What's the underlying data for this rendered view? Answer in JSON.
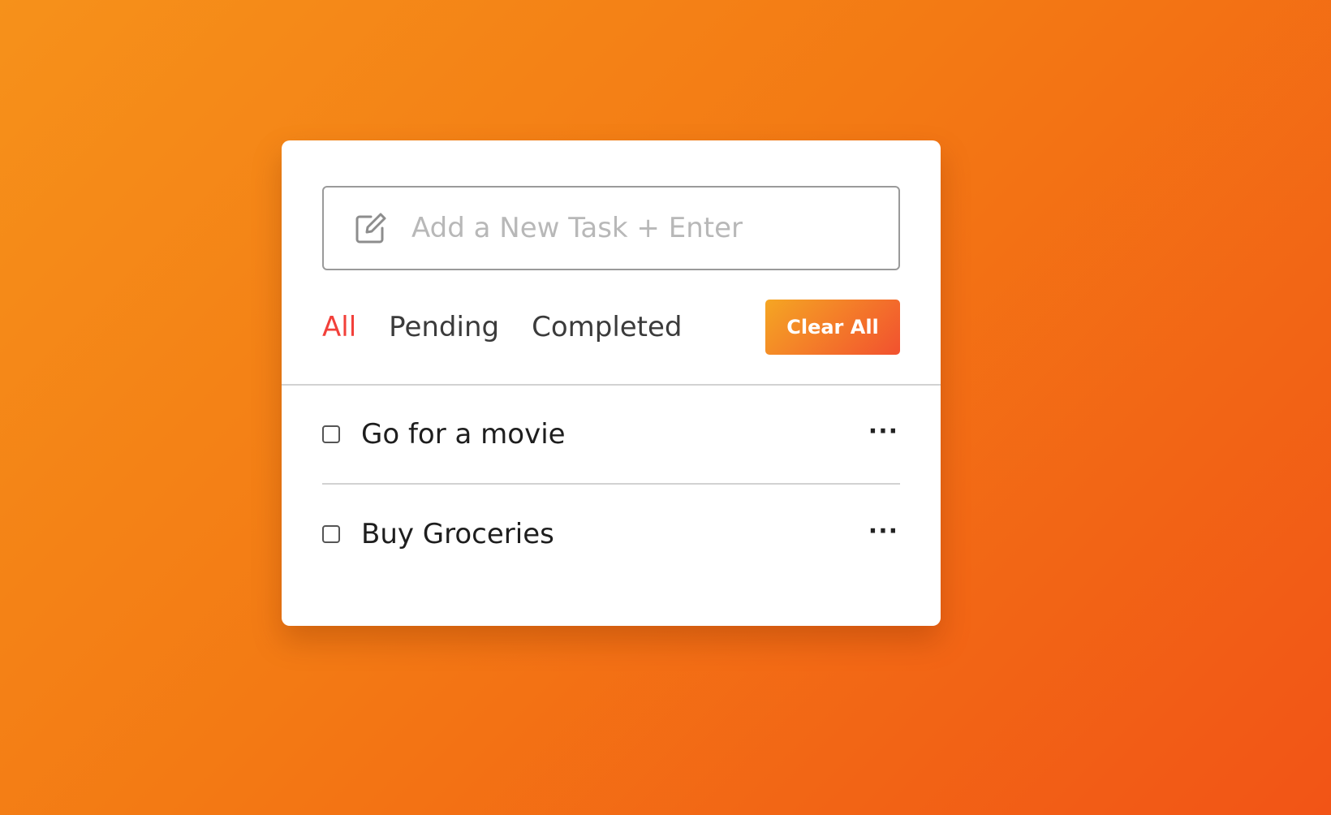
{
  "theme": {
    "background_gradient": [
      "#f6911a",
      "#f25416"
    ],
    "active_filter_color": "#f2403a",
    "button_gradient": [
      "#f5a623",
      "#f2512f"
    ]
  },
  "task_input": {
    "icon": "edit-icon",
    "placeholder": "Add a New Task + Enter",
    "value": ""
  },
  "filters": [
    {
      "label": "All",
      "active": true
    },
    {
      "label": "Pending",
      "active": false
    },
    {
      "label": "Completed",
      "active": false
    }
  ],
  "clear_all_label": "Clear All",
  "tasks": [
    {
      "label": "Go for a movie",
      "checked": false,
      "menu_icon": "more-horizontal-icon",
      "menu_glyph": "···"
    },
    {
      "label": "Buy Groceries",
      "checked": false,
      "menu_icon": "more-horizontal-icon",
      "menu_glyph": "···"
    }
  ]
}
